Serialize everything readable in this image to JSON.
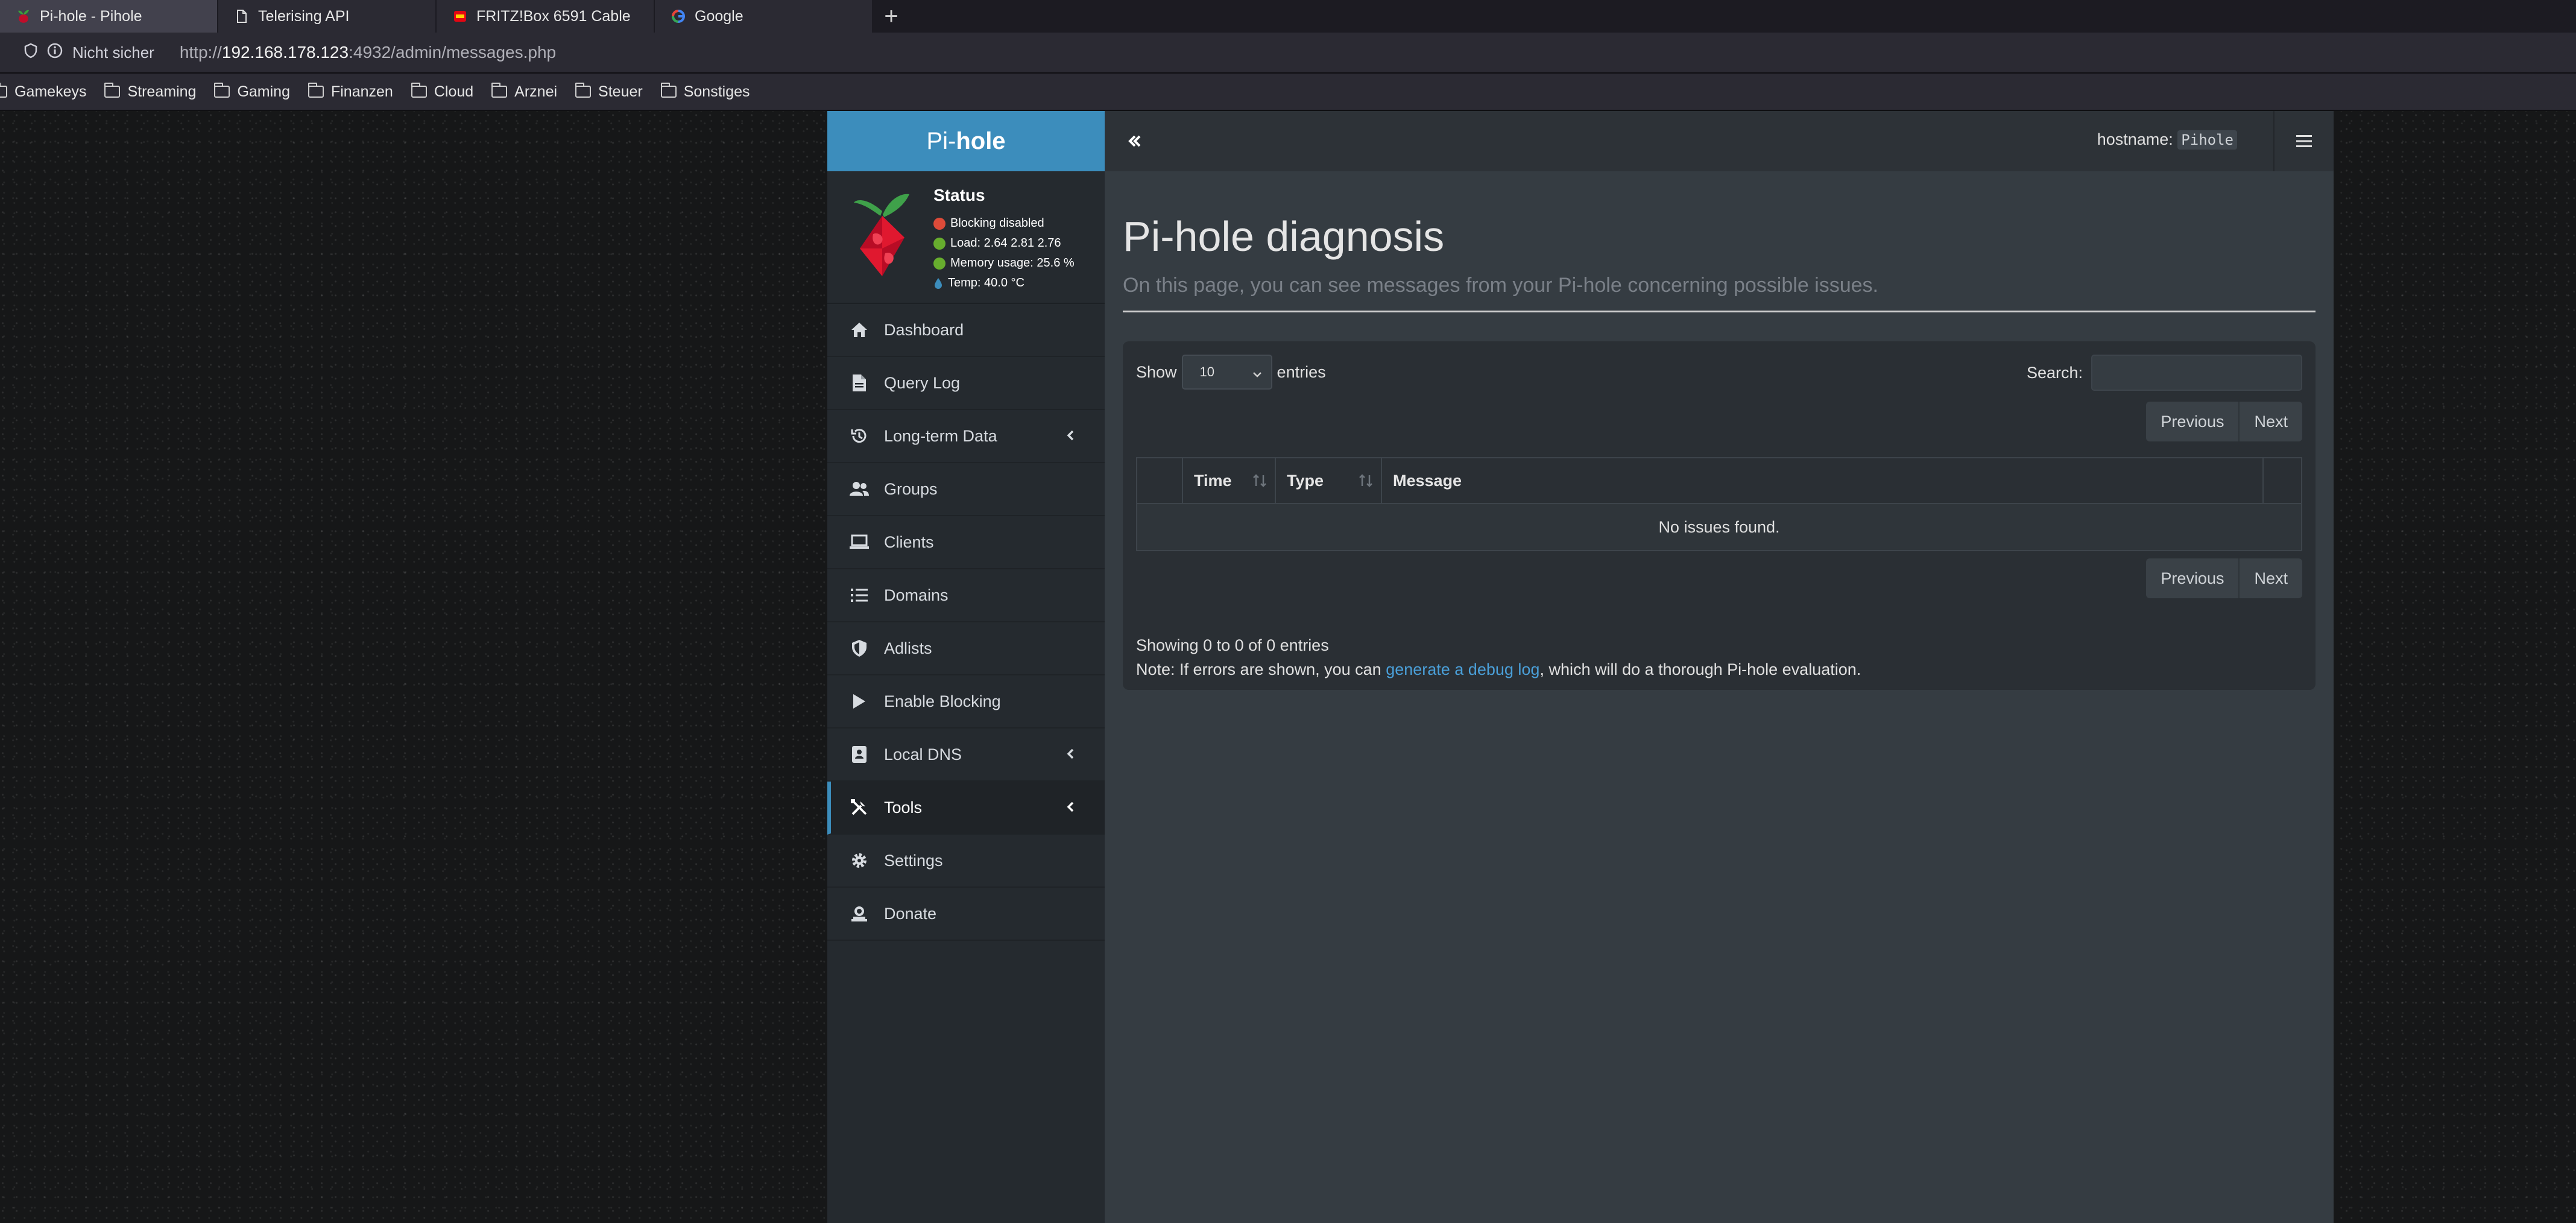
{
  "browser": {
    "tabs": [
      {
        "label": "Pi-hole - Pihole",
        "icon": "pihole-favicon",
        "active": true
      },
      {
        "label": "Telerising API",
        "icon": "document-icon",
        "active": false
      },
      {
        "label": "FRITZ!Box 6591 Cable",
        "icon": "fritzbox-favicon",
        "active": false
      },
      {
        "label": "Google",
        "icon": "google-favicon",
        "active": false
      }
    ],
    "new_tab": "+",
    "security_label": "Nicht sicher",
    "url_prefix": "http://",
    "url_host": "192.168.178.123",
    "url_rest": ":4932/admin/messages.php",
    "bookmarks": [
      "Gamekeys",
      "Streaming",
      "Gaming",
      "Finanzen",
      "Cloud",
      "Arznei",
      "Steuer",
      "Sonstiges"
    ]
  },
  "sidebar": {
    "logo_pre": "Pi-",
    "logo_bold": "hole",
    "status_title": "Status",
    "status": [
      {
        "text": "Blocking disabled",
        "color": "#dd4b39"
      },
      {
        "text": "Load:  2.64  2.81  2.76",
        "color": "#67ad2e"
      },
      {
        "text": "Memory usage:  25.6 %",
        "color": "#67ad2e"
      },
      {
        "text": "Temp: 40.0 °C",
        "color": "#3c8dbc"
      }
    ],
    "items": [
      {
        "label": "Dashboard",
        "icon": "home-icon"
      },
      {
        "label": "Query Log",
        "icon": "file-icon"
      },
      {
        "label": "Long-term Data",
        "icon": "history-icon"
      },
      {
        "label": "Groups",
        "icon": "users-icon"
      },
      {
        "label": "Clients",
        "icon": "laptop-icon"
      },
      {
        "label": "Domains",
        "icon": "list-icon"
      },
      {
        "label": "Adlists",
        "icon": "shield-icon"
      },
      {
        "label": "Enable Blocking",
        "icon": "play-icon"
      },
      {
        "label": "Local DNS",
        "icon": "address-book-icon"
      },
      {
        "label": "Tools",
        "icon": "tools-icon"
      },
      {
        "label": "Settings",
        "icon": "gear-icon"
      },
      {
        "label": "Donate",
        "icon": "donate-icon"
      }
    ],
    "accent": "#3c8dbc"
  },
  "topbar": {
    "hostname_label": "hostname:",
    "hostname_value": "Pihole"
  },
  "main": {
    "title": "Pi-hole diagnosis",
    "subtitle": "On this page, you can see messages from your Pi-hole concerning possible issues.",
    "show_label": "Show",
    "entries_value": "10",
    "entries_label": "entries",
    "search_label": "Search:",
    "previous": "Previous",
    "next": "Next",
    "columns": [
      "Time",
      "Type",
      "Message"
    ],
    "empty_text": "No issues found.",
    "showing": "Showing 0 to 0 of 0 entries",
    "note_pre": "Note: If errors are shown, you can ",
    "note_link": "generate a debug log",
    "note_post": ", which will do a thorough Pi-hole evaluation."
  }
}
